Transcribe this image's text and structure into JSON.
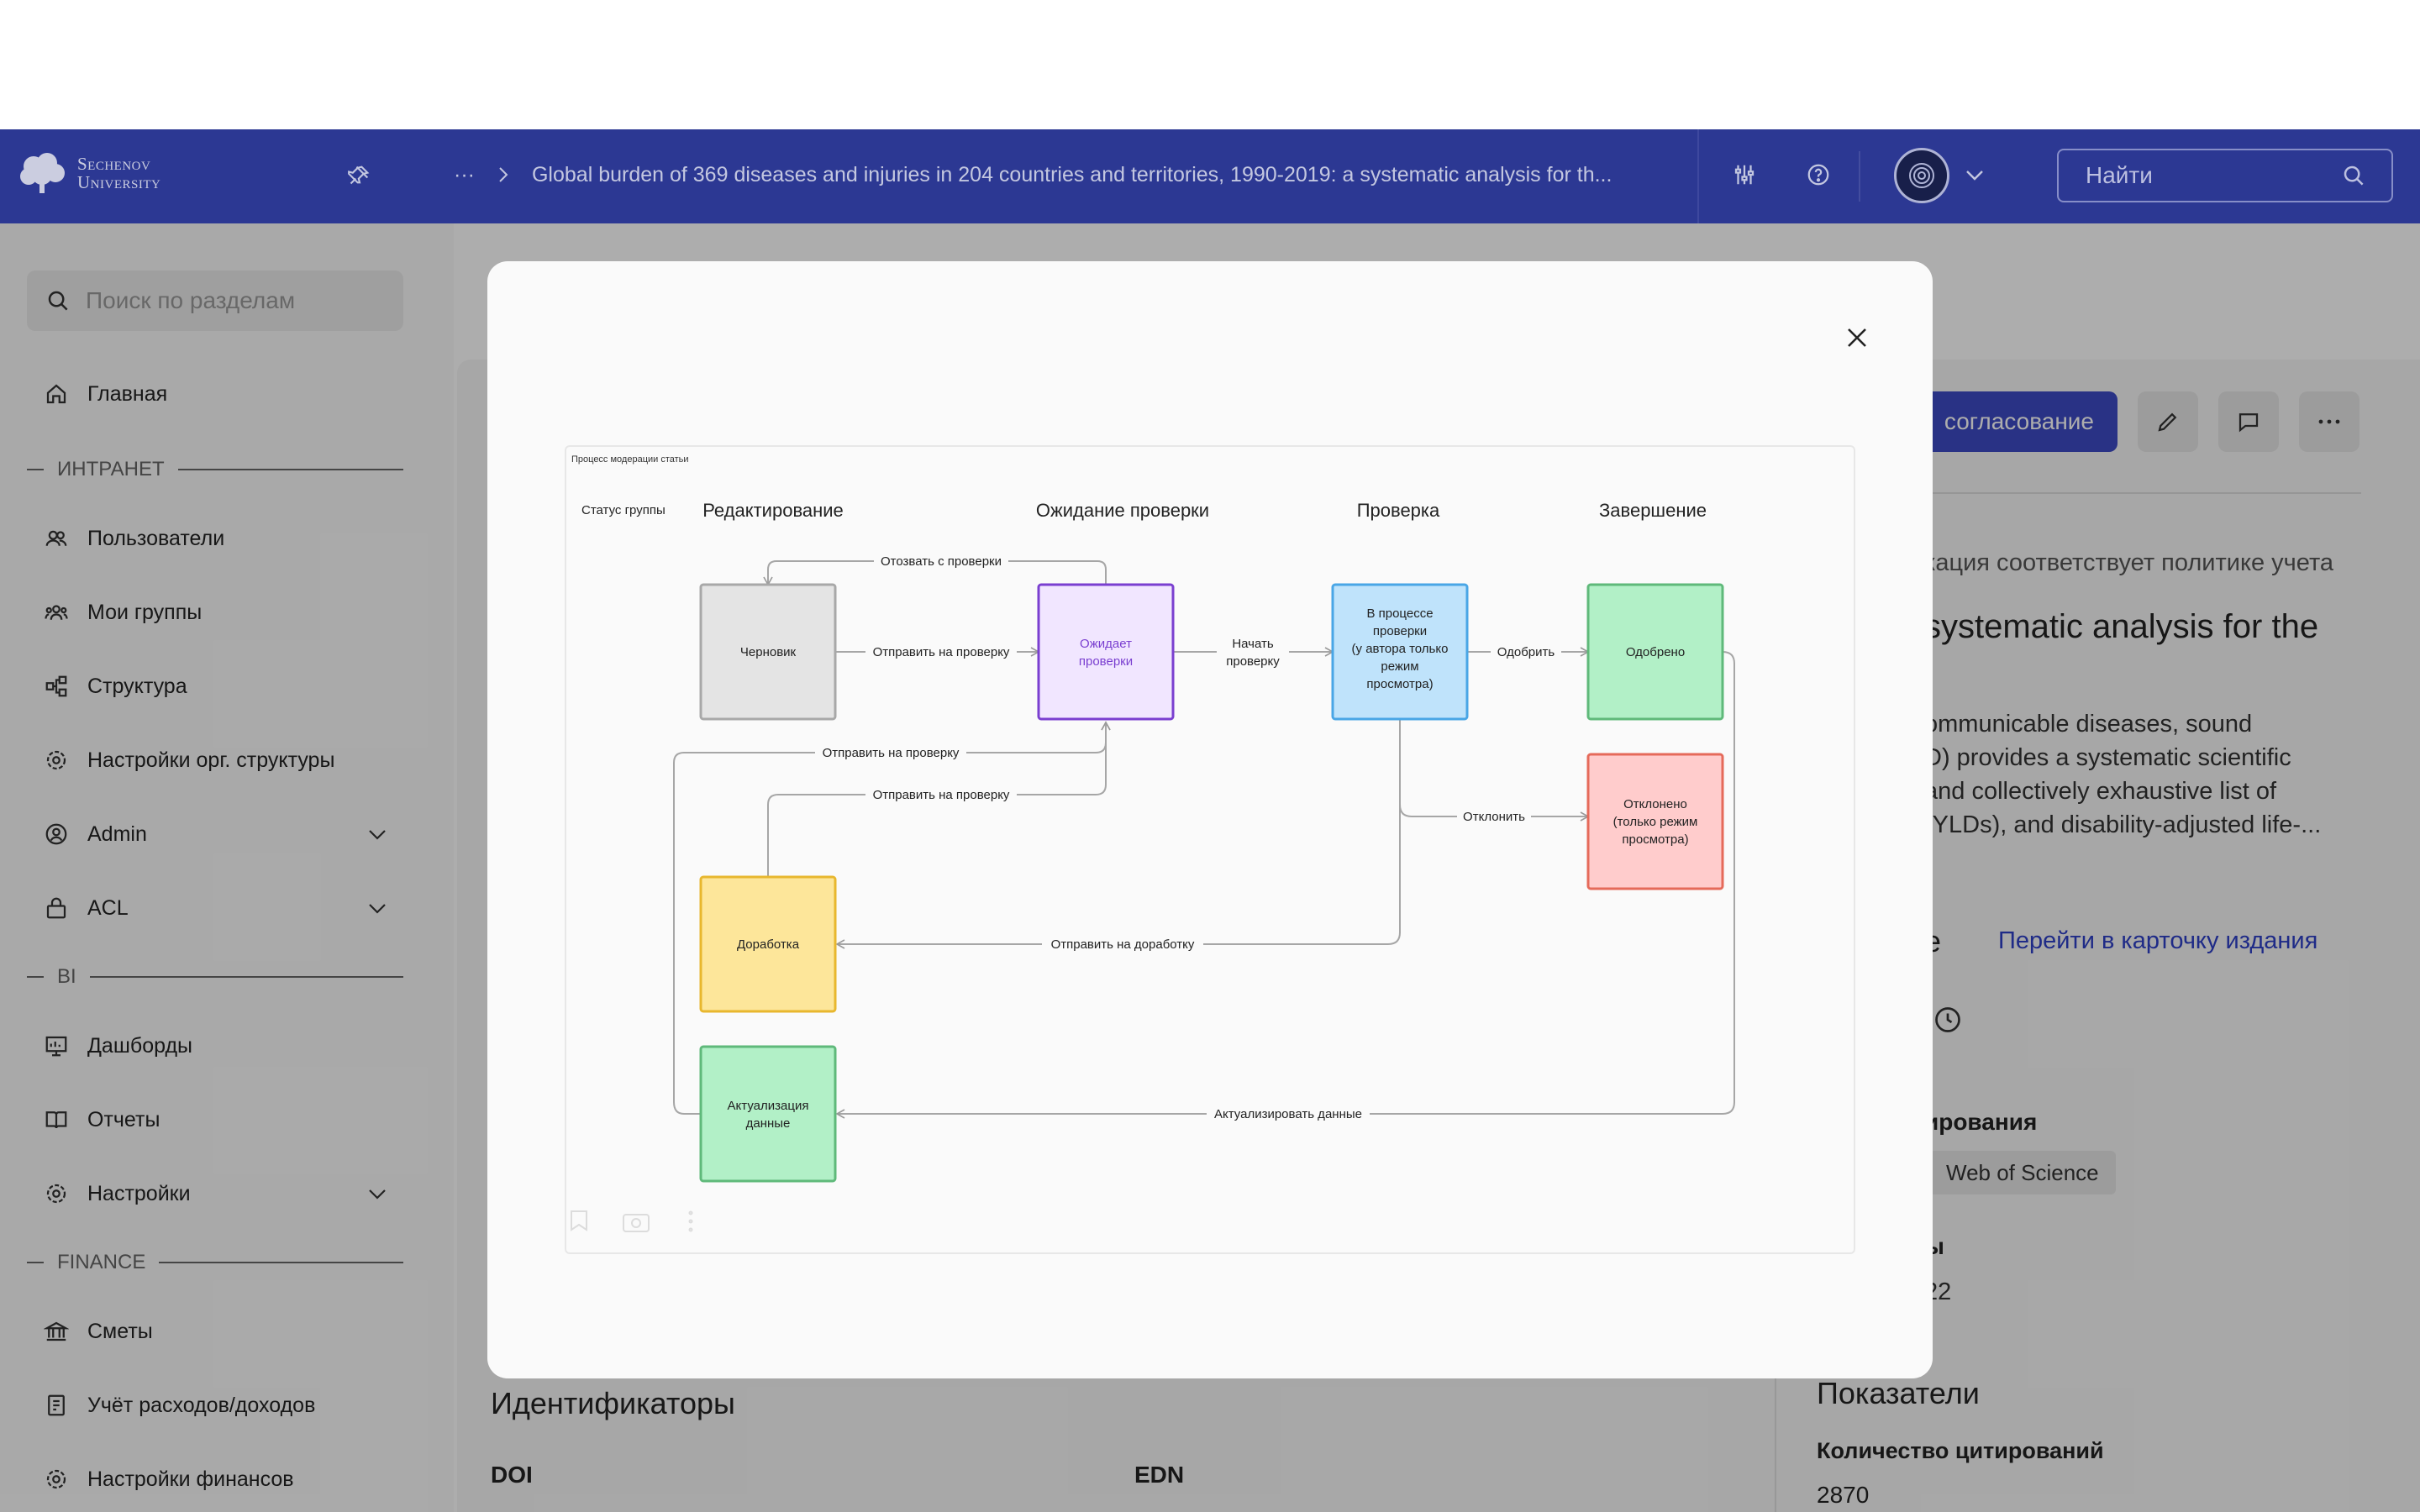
{
  "header": {
    "logo_line1": "Sechenov",
    "logo_line2": "University",
    "breadcrumb_more": "···",
    "breadcrumb_title": "Global burden of 369 diseases and injuries in 204 countries and territories, 1990-2019: a systematic analysis for th...",
    "search_placeholder": "Найти"
  },
  "sidebar": {
    "search_placeholder": "Поиск по разделам",
    "home": "Главная",
    "section_intranet": "ИНТРАНЕТ",
    "users": "Пользователи",
    "my_groups": "Мои группы",
    "structure": "Структура",
    "org_settings": "Настройки орг. структуры",
    "admin": "Admin",
    "acl": "ACL",
    "section_bi": "BI",
    "dashboards": "Дашборды",
    "reports": "Отчеты",
    "settings": "Настройки",
    "section_finance": "FINANCE",
    "estimates": "Сметы",
    "expenses": "Учёт расходов/доходов",
    "finance_settings": "Настройки финансов"
  },
  "main": {
    "approval_button": "согласование",
    "policy_text": "кация соответствует политике учета",
    "title_fragment": "systematic analysis for the",
    "abstract_line1": "ommunicable diseases, sound",
    "abstract_line2": "D) provides a systematic scientific",
    "abstract_line3": "and collectively exhaustive list of",
    "abstract_line4": "(YLDs), and disability-adjusted life-...",
    "edition_suffix": "е",
    "edition_link": "Перейти в карточку издания",
    "status_fragment": "t",
    "indexing_label": "ирования",
    "indexing_tag": "Web of Science",
    "field_label_fragment": "ы",
    "field_value_fragment": "22",
    "identifiers_heading": "Идентификаторы",
    "doi_label": "DOI",
    "edn_label": "EDN",
    "indicators_heading": "Показатели",
    "citations_label": "Количество цитирований",
    "citations_value": "2870"
  },
  "diagram": {
    "title": "Процесс модерации статьи",
    "group_status": "Статус группы",
    "col_editing": "Редактирование",
    "col_waiting": "Ожидание проверки",
    "col_review": "Проверка",
    "col_done": "Завершение",
    "box_draft": "Черновик",
    "box_waiting_1": "Ожидает",
    "box_waiting_2": "проверки",
    "box_review_1": "В процессе",
    "box_review_2": "проверки",
    "box_review_3": "(у автора только",
    "box_review_4": "режим",
    "box_review_5": "просмотра)",
    "box_approved": "Одобрено",
    "box_rejected_1": "Отклонено",
    "box_rejected_2": "(только режим",
    "box_rejected_3": "просмотра)",
    "box_rework": "Доработка",
    "box_update_1": "Актуализация",
    "box_update_2": "данные",
    "edge_withdraw": "Отозвать с проверки",
    "edge_send": "Отправить на проверку",
    "edge_start_1": "Начать",
    "edge_start_2": "проверку",
    "edge_approve": "Одобрить",
    "edge_send_2": "Отправить на проверку",
    "edge_send_3": "Отправить на проверку",
    "edge_reject": "Отклонить",
    "edge_rework": "Отправить на доработку",
    "edge_update": "Актуализировать данные"
  },
  "colors": {
    "header_bg": "#3340a8",
    "accent": "#3d4bc4",
    "link": "#2f40c8"
  }
}
